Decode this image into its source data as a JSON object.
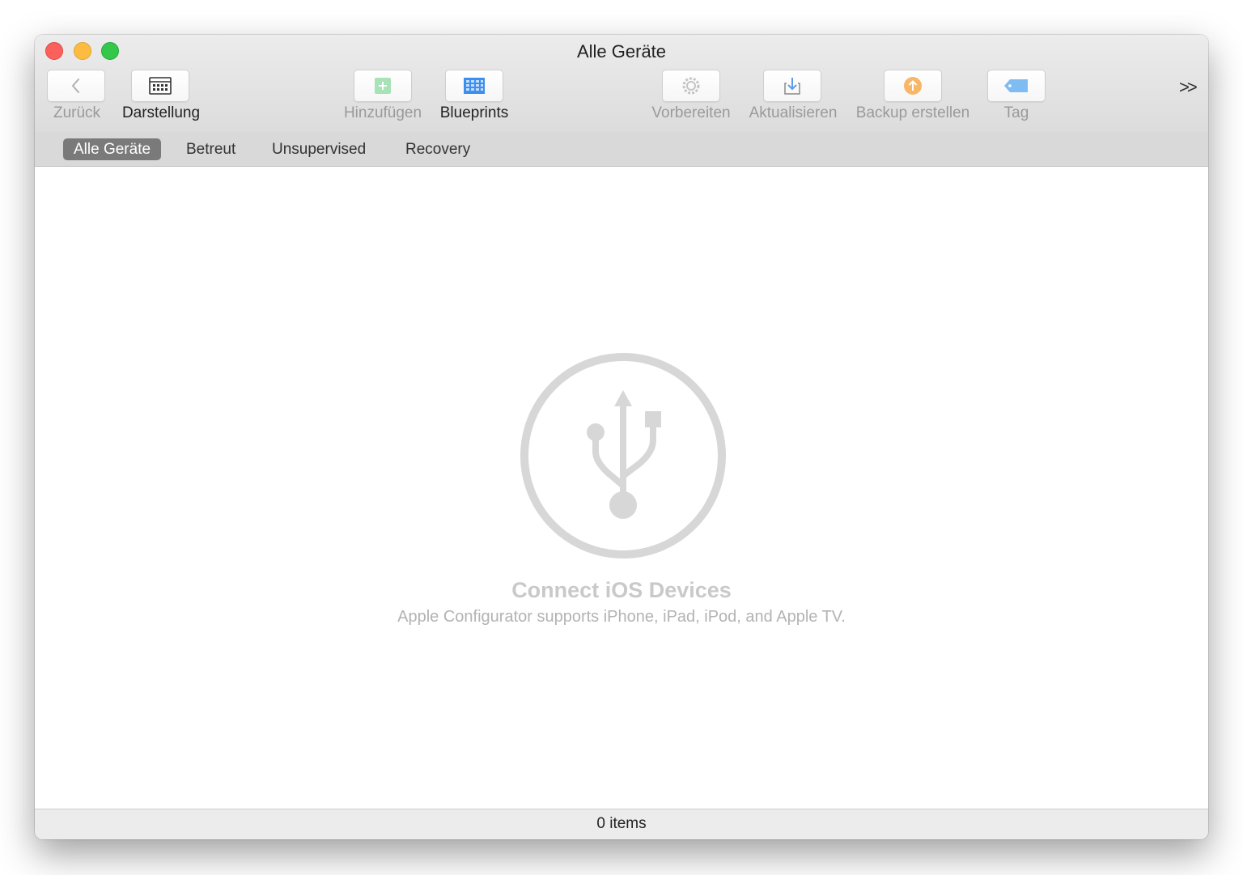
{
  "window": {
    "title": "Alle Geräte"
  },
  "toolbar": {
    "back_label": "Zurück",
    "view_label": "Darstellung",
    "add_label": "Hinzufügen",
    "blueprints_label": "Blueprints",
    "prepare_label": "Vorbereiten",
    "update_label": "Aktualisieren",
    "backup_label": "Backup erstellen",
    "tag_label": "Tag",
    "overflow_glyph": ">>"
  },
  "scope_bar": {
    "items": [
      {
        "label": "Alle Geräte",
        "selected": true
      },
      {
        "label": "Betreut",
        "selected": false
      },
      {
        "label": "Unsupervised",
        "selected": false
      },
      {
        "label": "Recovery",
        "selected": false
      }
    ]
  },
  "empty_state": {
    "icon": "usb-icon",
    "title": "Connect iOS Devices",
    "subtitle": "Apple Configurator supports iPhone, iPad, iPod, and Apple TV."
  },
  "status": {
    "count_text": "0 items"
  },
  "colors": {
    "close": "#fc605c",
    "minimize": "#fdbc40",
    "zoom": "#34c84a",
    "selected_scope": "#7a7a7a",
    "empty_icon": "#d7d7d7"
  }
}
